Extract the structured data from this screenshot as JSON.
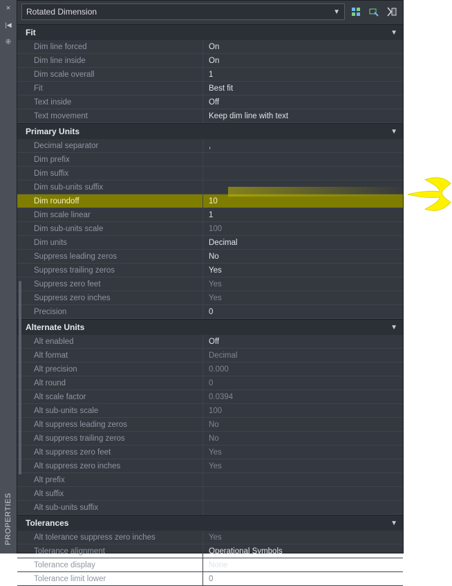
{
  "panel_title": "PROPERTIES",
  "type_selector": "Rotated Dimension",
  "left_icons": {
    "close": "×",
    "pin": "📌",
    "opts": "⁜"
  },
  "top_icons": {
    "i1": "quick-select-icon",
    "i2": "selection-bottom-icon",
    "i3": "deselect-icon"
  },
  "chevron": "▼",
  "sections": [
    {
      "title": "Fit",
      "rows": [
        {
          "label": "Dim line forced",
          "value": "On",
          "dim": false
        },
        {
          "label": "Dim line inside",
          "value": "On",
          "dim": false
        },
        {
          "label": "Dim scale overall",
          "value": "1",
          "dim": false
        },
        {
          "label": "Fit",
          "value": "Best fit",
          "dim": false
        },
        {
          "label": "Text inside",
          "value": "Off",
          "dim": false
        },
        {
          "label": "Text movement",
          "value": "Keep dim line with text",
          "dim": false
        }
      ]
    },
    {
      "title": "Primary Units",
      "rows": [
        {
          "label": "Decimal separator",
          "value": ",",
          "dim": false
        },
        {
          "label": "Dim prefix",
          "value": "",
          "dim": false
        },
        {
          "label": "Dim suffix",
          "value": "",
          "dim": false
        },
        {
          "label": "Dim sub-units suffix",
          "value": "",
          "dim": false
        },
        {
          "label": "Dim roundoff",
          "value": "10",
          "dim": false,
          "hl": true
        },
        {
          "label": "Dim scale linear",
          "value": "1",
          "dim": false
        },
        {
          "label": "Dim sub-units scale",
          "value": "100",
          "dim": true
        },
        {
          "label": "Dim units",
          "value": "Decimal",
          "dim": false
        },
        {
          "label": "Suppress leading zeros",
          "value": "No",
          "dim": false
        },
        {
          "label": "Suppress trailing zeros",
          "value": "Yes",
          "dim": false
        },
        {
          "label": "Suppress zero feet",
          "value": "Yes",
          "dim": true
        },
        {
          "label": "Suppress zero inches",
          "value": "Yes",
          "dim": true
        },
        {
          "label": "Precision",
          "value": "0",
          "dim": false
        }
      ]
    },
    {
      "title": "Alternate Units",
      "rows": [
        {
          "label": "Alt enabled",
          "value": "Off",
          "dim": false
        },
        {
          "label": "Alt format",
          "value": "Decimal",
          "dim": true
        },
        {
          "label": "Alt precision",
          "value": "0.000",
          "dim": true
        },
        {
          "label": "Alt round",
          "value": "0",
          "dim": true
        },
        {
          "label": "Alt scale factor",
          "value": "0.0394",
          "dim": true
        },
        {
          "label": "Alt sub-units scale",
          "value": "100",
          "dim": true
        },
        {
          "label": "Alt suppress leading zeros",
          "value": "No",
          "dim": true
        },
        {
          "label": "Alt suppress trailing zeros",
          "value": "No",
          "dim": true
        },
        {
          "label": "Alt suppress zero feet",
          "value": "Yes",
          "dim": true
        },
        {
          "label": "Alt suppress zero inches",
          "value": "Yes",
          "dim": true
        },
        {
          "label": "Alt prefix",
          "value": "",
          "dim": true
        },
        {
          "label": "Alt suffix",
          "value": "",
          "dim": true
        },
        {
          "label": "Alt sub-units suffix",
          "value": "",
          "dim": true
        }
      ]
    },
    {
      "title": "Tolerances",
      "rows": [
        {
          "label": "Alt tolerance suppress zero inches",
          "value": "Yes",
          "dim": true
        },
        {
          "label": "Tolerance alignment",
          "value": "Operational Symbols",
          "dim": false
        },
        {
          "label": "Tolerance display",
          "value": "None",
          "dim": false
        },
        {
          "label": "Tolerance limit lower",
          "value": "0",
          "dim": true
        }
      ]
    }
  ]
}
